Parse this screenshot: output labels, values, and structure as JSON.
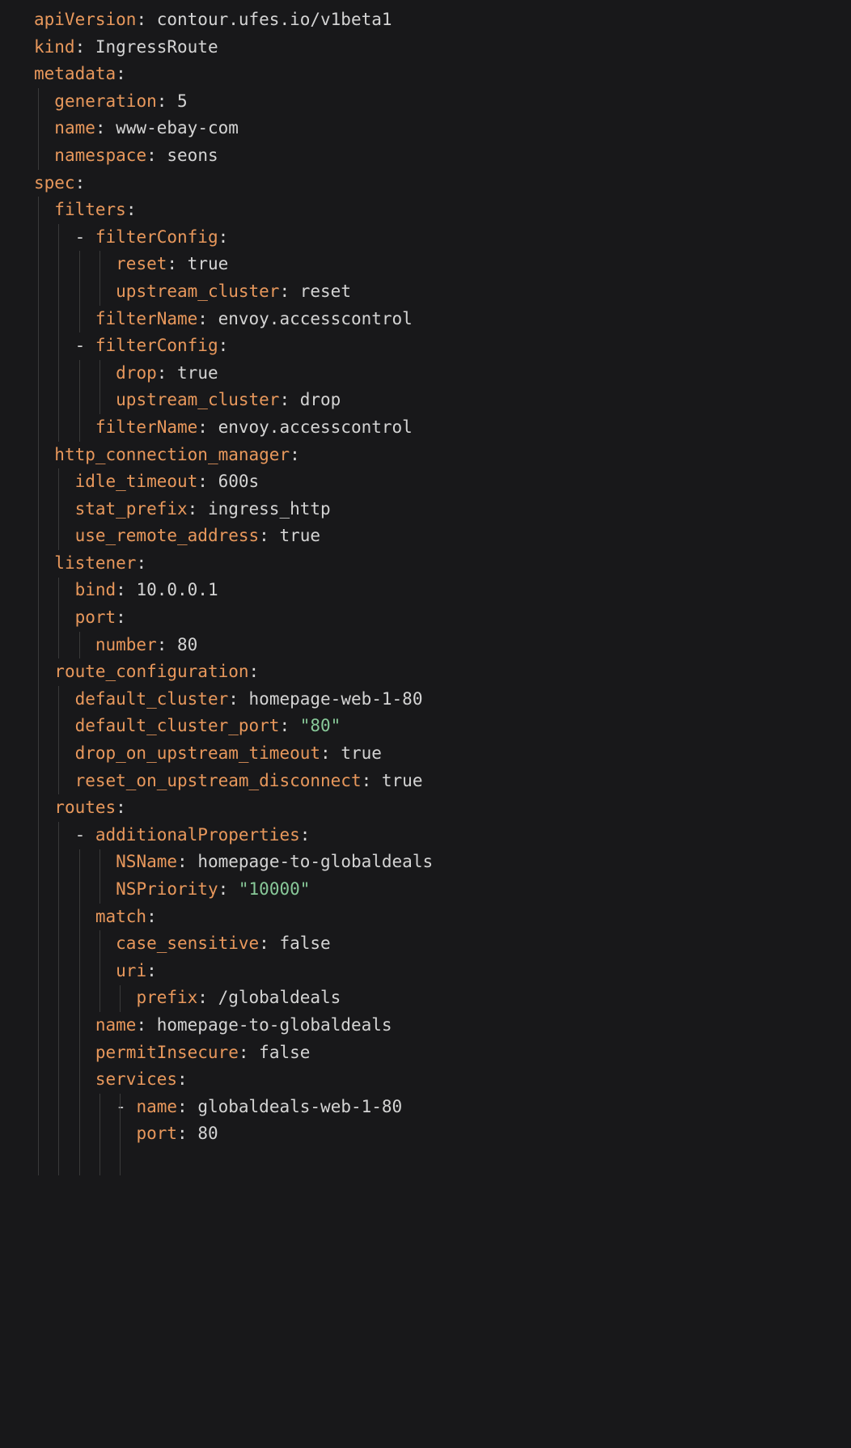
{
  "lines": [
    {
      "indent": 0,
      "dash": false,
      "key": "apiVersion",
      "sep": ": ",
      "val": "contour.ufes.io/v1beta1",
      "valClass": "val"
    },
    {
      "indent": 0,
      "dash": false,
      "key": "kind",
      "sep": ": ",
      "val": "IngressRoute",
      "valClass": "val"
    },
    {
      "indent": 0,
      "dash": false,
      "key": "metadata",
      "sep": ":",
      "val": "",
      "valClass": "val"
    },
    {
      "indent": 1,
      "dash": false,
      "key": "generation",
      "sep": ": ",
      "val": "5",
      "valClass": "val"
    },
    {
      "indent": 1,
      "dash": false,
      "key": "name",
      "sep": ": ",
      "val": "www-ebay-com",
      "valClass": "val"
    },
    {
      "indent": 1,
      "dash": false,
      "key": "namespace",
      "sep": ": ",
      "val": "seons",
      "valClass": "val"
    },
    {
      "indent": 0,
      "dash": false,
      "key": "spec",
      "sep": ":",
      "val": "",
      "valClass": "val"
    },
    {
      "indent": 1,
      "dash": false,
      "key": "filters",
      "sep": ":",
      "val": "",
      "valClass": "val"
    },
    {
      "indent": 2,
      "dash": true,
      "key": "filterConfig",
      "sep": ":",
      "val": "",
      "valClass": "val"
    },
    {
      "indent": 4,
      "dash": false,
      "key": "reset",
      "sep": ": ",
      "val": "true",
      "valClass": "val"
    },
    {
      "indent": 4,
      "dash": false,
      "key": "upstream_cluster",
      "sep": ": ",
      "val": "reset",
      "valClass": "val"
    },
    {
      "indent": 3,
      "dash": false,
      "key": "filterName",
      "sep": ": ",
      "val": "envoy.accesscontrol",
      "valClass": "val"
    },
    {
      "indent": 2,
      "dash": true,
      "key": "filterConfig",
      "sep": ":",
      "val": "",
      "valClass": "val"
    },
    {
      "indent": 4,
      "dash": false,
      "key": "drop",
      "sep": ": ",
      "val": "true",
      "valClass": "val"
    },
    {
      "indent": 4,
      "dash": false,
      "key": "upstream_cluster",
      "sep": ": ",
      "val": "drop",
      "valClass": "val"
    },
    {
      "indent": 3,
      "dash": false,
      "key": "filterName",
      "sep": ": ",
      "val": "envoy.accesscontrol",
      "valClass": "val"
    },
    {
      "indent": 1,
      "dash": false,
      "key": "http_connection_manager",
      "sep": ":",
      "val": "",
      "valClass": "val"
    },
    {
      "indent": 2,
      "dash": false,
      "key": "idle_timeout",
      "sep": ": ",
      "val": "600s",
      "valClass": "val"
    },
    {
      "indent": 2,
      "dash": false,
      "key": "stat_prefix",
      "sep": ": ",
      "val": "ingress_http",
      "valClass": "val"
    },
    {
      "indent": 2,
      "dash": false,
      "key": "use_remote_address",
      "sep": ": ",
      "val": "true",
      "valClass": "val"
    },
    {
      "indent": 1,
      "dash": false,
      "key": "listener",
      "sep": ":",
      "val": "",
      "valClass": "val"
    },
    {
      "indent": 2,
      "dash": false,
      "key": "bind",
      "sep": ": ",
      "val": "10.0.0.1",
      "valClass": "val"
    },
    {
      "indent": 2,
      "dash": false,
      "key": "port",
      "sep": ":",
      "val": "",
      "valClass": "val"
    },
    {
      "indent": 3,
      "dash": false,
      "key": "number",
      "sep": ": ",
      "val": "80",
      "valClass": "val"
    },
    {
      "indent": 1,
      "dash": false,
      "key": "route_configuration",
      "sep": ":",
      "val": "",
      "valClass": "val"
    },
    {
      "indent": 2,
      "dash": false,
      "key": "default_cluster",
      "sep": ": ",
      "val": "homepage-web-1-80",
      "valClass": "val"
    },
    {
      "indent": 2,
      "dash": false,
      "key": "default_cluster_port",
      "sep": ": ",
      "val": "\"80\"",
      "valClass": "str"
    },
    {
      "indent": 2,
      "dash": false,
      "key": "drop_on_upstream_timeout",
      "sep": ": ",
      "val": "true",
      "valClass": "val"
    },
    {
      "indent": 2,
      "dash": false,
      "key": "reset_on_upstream_disconnect",
      "sep": ": ",
      "val": "true",
      "valClass": "val"
    },
    {
      "indent": 1,
      "dash": false,
      "key": "routes",
      "sep": ":",
      "val": "",
      "valClass": "val"
    },
    {
      "indent": 2,
      "dash": true,
      "key": "additionalProperties",
      "sep": ":",
      "val": "",
      "valClass": "val"
    },
    {
      "indent": 4,
      "dash": false,
      "key": "NSName",
      "sep": ": ",
      "val": "homepage-to-globaldeals",
      "valClass": "val"
    },
    {
      "indent": 4,
      "dash": false,
      "key": "NSPriority",
      "sep": ": ",
      "val": "\"10000\"",
      "valClass": "str"
    },
    {
      "indent": 3,
      "dash": false,
      "key": "match",
      "sep": ":",
      "val": "",
      "valClass": "val"
    },
    {
      "indent": 4,
      "dash": false,
      "key": "case_sensitive",
      "sep": ": ",
      "val": "false",
      "valClass": "val"
    },
    {
      "indent": 4,
      "dash": false,
      "key": "uri",
      "sep": ":",
      "val": "",
      "valClass": "val"
    },
    {
      "indent": 5,
      "dash": false,
      "key": "prefix",
      "sep": ": ",
      "val": "/globaldeals",
      "valClass": "val"
    },
    {
      "indent": 3,
      "dash": false,
      "key": "name",
      "sep": ": ",
      "val": "homepage-to-globaldeals",
      "valClass": "val"
    },
    {
      "indent": 3,
      "dash": false,
      "key": "permitInsecure",
      "sep": ": ",
      "val": "false",
      "valClass": "val"
    },
    {
      "indent": 3,
      "dash": false,
      "key": "services",
      "sep": ":",
      "val": "",
      "valClass": "val"
    },
    {
      "indent": 4,
      "dash": true,
      "key": "name",
      "sep": ": ",
      "val": "globaldeals-web-1-80",
      "valClass": "val"
    },
    {
      "indent": 5,
      "dash": false,
      "key": "port",
      "sep": ": ",
      "val": "80",
      "valClass": "val"
    },
    {
      "indent": 5,
      "dash": false,
      "key": "",
      "sep": "",
      "val": "",
      "valClass": "val"
    }
  ],
  "guides": [
    {
      "col": 0,
      "start": 3,
      "end": 5
    },
    {
      "col": 0,
      "start": 7,
      "end": 42
    },
    {
      "col": 1,
      "start": 8,
      "end": 15
    },
    {
      "col": 2,
      "start": 9,
      "end": 11
    },
    {
      "col": 3,
      "start": 9,
      "end": 10
    },
    {
      "col": 2,
      "start": 13,
      "end": 15
    },
    {
      "col": 3,
      "start": 13,
      "end": 14
    },
    {
      "col": 1,
      "start": 17,
      "end": 19
    },
    {
      "col": 1,
      "start": 21,
      "end": 23
    },
    {
      "col": 2,
      "start": 23,
      "end": 23
    },
    {
      "col": 1,
      "start": 25,
      "end": 28
    },
    {
      "col": 1,
      "start": 30,
      "end": 42
    },
    {
      "col": 2,
      "start": 31,
      "end": 42
    },
    {
      "col": 3,
      "start": 31,
      "end": 32
    },
    {
      "col": 3,
      "start": 34,
      "end": 36
    },
    {
      "col": 4,
      "start": 36,
      "end": 36
    },
    {
      "col": 3,
      "start": 40,
      "end": 42
    },
    {
      "col": 4,
      "start": 40,
      "end": 42
    }
  ],
  "indentUnit": "  "
}
